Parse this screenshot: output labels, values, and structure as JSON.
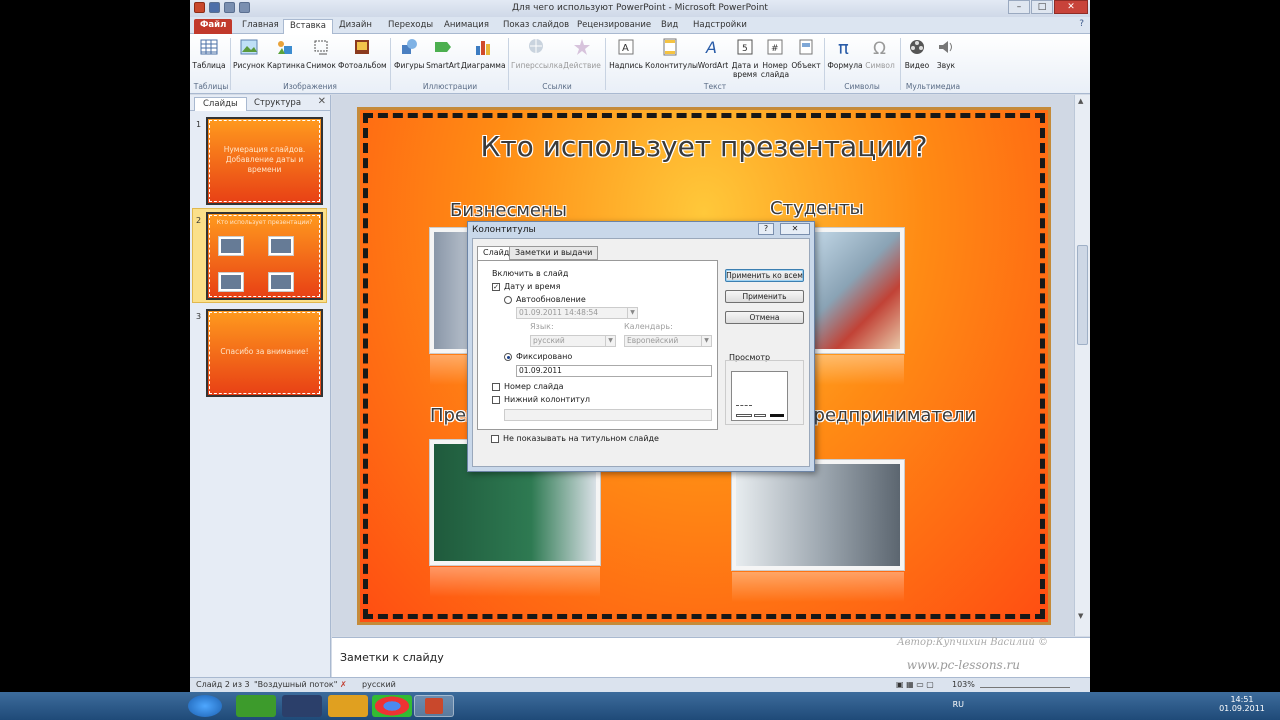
{
  "window": {
    "title": "Для чего используют PowerPoint - Microsoft PowerPoint",
    "min": "–",
    "max": "□",
    "close": "✕"
  },
  "tabs": [
    "Файл",
    "Главная",
    "Вставка",
    "Дизайн",
    "Переходы",
    "Анимация",
    "Показ слайдов",
    "Рецензирование",
    "Вид",
    "Надстройки"
  ],
  "ribbon": {
    "buttons": [
      "Таблица",
      "Рисунок",
      "Картинка",
      "Снимок",
      "Фотоальбом",
      "Фигуры",
      "SmartArt",
      "Диаграмма",
      "Гиперссылка",
      "Действие",
      "Надпись",
      "Колонтитулы",
      "WordArt",
      "Дата и время",
      "Номер слайда",
      "Объект",
      "Формула",
      "Символ",
      "Видео",
      "Звук"
    ],
    "groups": [
      "Таблицы",
      "Изображения",
      "Иллюстрации",
      "Ссылки",
      "Текст",
      "Символы",
      "Мультимедиа"
    ]
  },
  "left_panel": {
    "tabs": [
      "Слайды",
      "Структура"
    ],
    "close": "✕",
    "slides": [
      {
        "num": "1",
        "text": "Нумерация слайдов. Добавление даты и времени"
      },
      {
        "num": "2",
        "text": "Кто использует презентации?"
      },
      {
        "num": "3",
        "text": "Спасибо за внимание!"
      }
    ]
  },
  "slide": {
    "title": "Кто использует презентации?",
    "labels": [
      "Бизнесмены",
      "Студенты",
      "Преподаватели",
      "Предприниматели"
    ]
  },
  "notes": {
    "placeholder": "Заметки к слайду",
    "author": "Автор:Купчихин Василий ©",
    "site": "www.pc-lessons.ru"
  },
  "status": {
    "slide": "Слайд 2 из 3",
    "theme": "\"Воздушный поток\"",
    "lang": "русский",
    "zoom": "103%"
  },
  "dialog": {
    "title": "Колонтитулы",
    "help": "?",
    "close": "✕",
    "tabs": [
      "Слайд",
      "Заметки и выдачи"
    ],
    "include_label": "Включить в слайд",
    "date_time": {
      "label": "Дату и время",
      "checked": true
    },
    "auto_update": {
      "label": "Автообновление",
      "value": "01.09.2011 14:48:54"
    },
    "language_label": "Язык:",
    "language_value": "русский",
    "calendar_label": "Календарь:",
    "calendar_value": "Европейский",
    "fixed": {
      "label": "Фиксировано",
      "value": "01.09.2011"
    },
    "slide_number": {
      "label": "Номер слайда",
      "checked": false
    },
    "footer": {
      "label": "Нижний колонтитул",
      "checked": false,
      "value": ""
    },
    "dont_show_title": {
      "label": "Не показывать на титульном слайде",
      "checked": false
    },
    "buttons": {
      "apply_all": "Применить ко всем",
      "apply": "Применить",
      "cancel": "Отмена"
    },
    "preview_label": "Просмотр"
  },
  "taskbar": {
    "lang": "RU",
    "time": "14:51",
    "date": "01.09.2011"
  }
}
